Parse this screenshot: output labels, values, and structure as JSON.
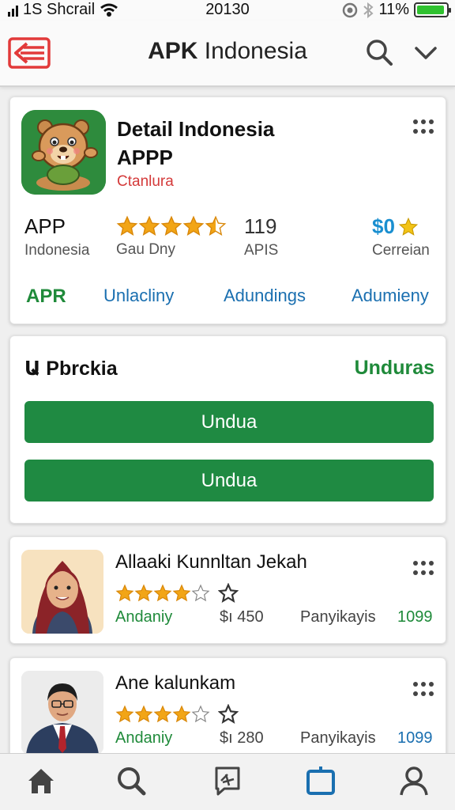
{
  "status_bar": {
    "carrier": "1S Shcrail",
    "time": "20130",
    "battery_percent": "11%",
    "battery_level": 0.95
  },
  "app_bar": {
    "title_bold": "APK",
    "title_rest": " Indonesia",
    "icons": [
      "back-icon",
      "search-icon",
      "chevron-down-icon"
    ]
  },
  "app_detail": {
    "name_line1": "Detail Indonesia",
    "name_line2": "APPP",
    "developer": "Ctanlura",
    "stats": [
      {
        "big": "APP",
        "small": "Indonesia"
      },
      {
        "rating": 4.5,
        "small": "Gau Dny"
      },
      {
        "big": "119",
        "small": "APIS"
      },
      {
        "big": "$0",
        "small": "Cerreian"
      }
    ],
    "tabs": [
      "APR",
      "Unlacliny",
      "Adundings",
      "Adumieny"
    ]
  },
  "download": {
    "title": "Ա Pbrckia",
    "status": "Unduras",
    "buttons": [
      "Undua",
      "Undua"
    ]
  },
  "items": [
    {
      "title": "Allaaki Kunnltan Jekah",
      "rating": 4,
      "label": "Andaniy",
      "size": "$ı 450",
      "category": "Panyikayis",
      "count": "1099"
    },
    {
      "title": "Ane kalunkam",
      "rating": 4,
      "label": "Andaniy",
      "size": "$ı 280",
      "category": "Panyikayis",
      "count": "1099"
    }
  ],
  "bottom_nav": [
    "home-icon",
    "search-icon",
    "news-icon",
    "apps-icon",
    "profile-icon"
  ],
  "colors": {
    "accent_green": "#1f8a42",
    "link_blue": "#1a6fb0",
    "developer_red": "#d43a3a",
    "star": "#f2a516",
    "active_nav": "#1a6fb0"
  }
}
